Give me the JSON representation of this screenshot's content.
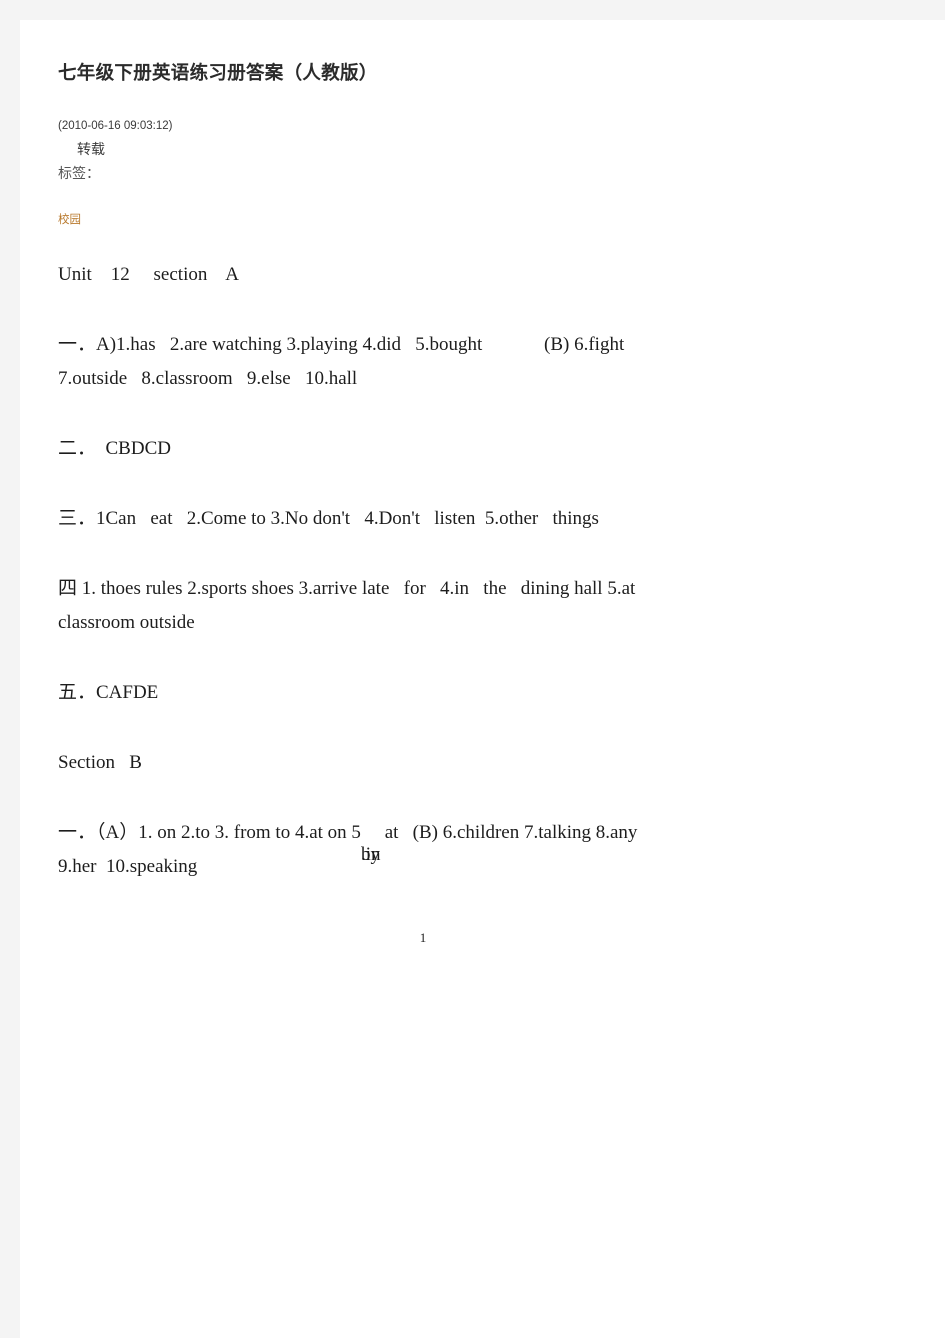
{
  "document": {
    "title": "七年级下册英语练习册答案（人教版）",
    "timestamp": "(2010-06-16  09:03:12)",
    "repost_label": "转载",
    "tags_label": "标签：",
    "tag": "校园",
    "page_number": "1",
    "accent_color": "#b97a2e",
    "text_color": "#1d1d1d",
    "page_background": "#ffffff",
    "canvas_background": "#f4f4f4"
  },
  "body": {
    "lines": [
      {
        "id": "unit-heading",
        "text": "Unit    12     section    A",
        "spaced": false
      },
      {
        "id": "section-1-line-1",
        "text": "一．A)1.has   2.are watching 3.playing 4.did   5.bought             (B) 6.fight",
        "spaced": true
      },
      {
        "id": "section-1-line-2",
        "text": "7.outside   8.classroom   9.else   10.hall",
        "spaced": false
      },
      {
        "id": "section-2",
        "text": "二．  CBDCD",
        "spaced": true
      },
      {
        "id": "section-3",
        "text": "三．1Can   eat   2.Come to 3.No don't   4.Don't   listen  5.other   things",
        "spaced": true
      },
      {
        "id": "section-4-line-1",
        "text": "四 1. thoes rules 2.sports shoes 3.arrive late   for   4.in   the   dining hall 5.at",
        "spaced": true
      },
      {
        "id": "section-4-line-2",
        "text": "classroom outside",
        "spaced": false
      },
      {
        "id": "section-5",
        "text": "五．CAFDE",
        "spaced": true
      },
      {
        "id": "section-b-heading",
        "text": "Section   B",
        "spaced": true
      }
    ],
    "section_b": {
      "line_1_before": "一．（A）1. on 2.to 3. from to 4.at on 5",
      "line_1_overlap_a": ".in",
      "line_1_overlap_b": "by",
      "line_1_after": "     at   (B) 6.children 7.talking 8.any",
      "line_2": "9.her  10.speaking"
    }
  }
}
